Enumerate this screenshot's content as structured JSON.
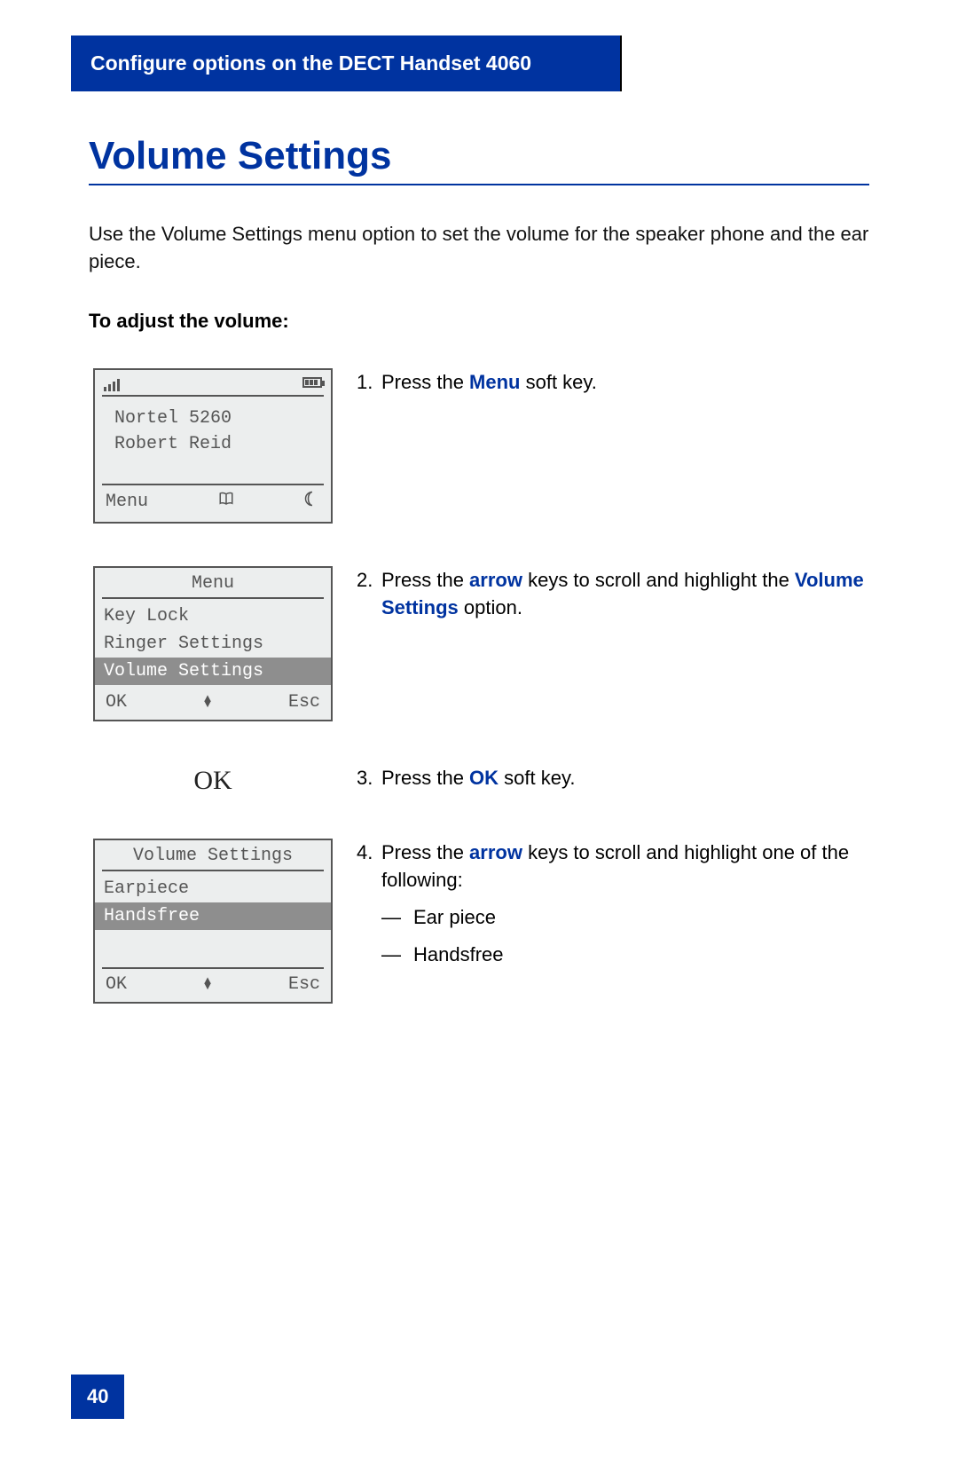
{
  "header": "Configure options on the DECT Handset 4060",
  "title": "Volume Settings",
  "intro": "Use the Volume Settings menu option to set the volume for the speaker phone and the ear piece.",
  "subheading": "To adjust the volume:",
  "page_number": "40",
  "step1": {
    "num": "1.",
    "pre": "Press the ",
    "key": "Menu",
    "post": " soft key."
  },
  "step2": {
    "num": "2.",
    "pre": "Press the ",
    "key1": "arrow",
    "mid": " keys to scroll and highlight the ",
    "key2": "Volume Settings",
    "post": " option."
  },
  "step3": {
    "num": "3.",
    "pre": "Press the ",
    "key": "OK",
    "post": " soft key.",
    "big_label": "OK"
  },
  "step4": {
    "num": "4.",
    "pre": "Press the ",
    "key": "arrow",
    "post": " keys to scroll and highlight one of the following:",
    "opt1": "Ear piece",
    "opt2": "Handsfree"
  },
  "screen1": {
    "line1": "Nortel 5260",
    "line2": "Robert Reid",
    "sk_left": "Menu"
  },
  "screen2": {
    "title": "Menu",
    "item1": "Key Lock",
    "item2": "Ringer Settings",
    "item3": "Volume Settings",
    "sk_left": "OK",
    "sk_right": "Esc"
  },
  "screen3": {
    "title": "Volume Settings",
    "item1": "Earpiece",
    "item2": "Handsfree",
    "sk_left": "OK",
    "sk_right": "Esc"
  }
}
